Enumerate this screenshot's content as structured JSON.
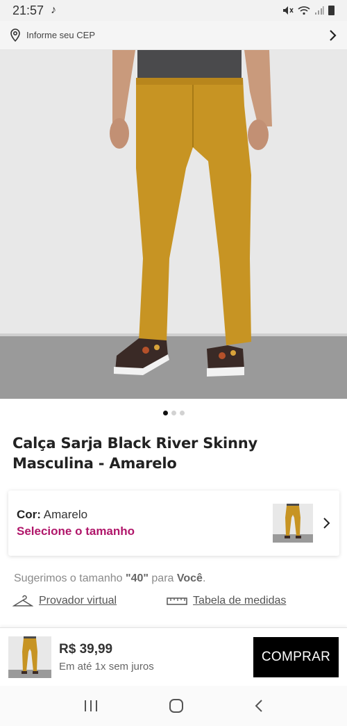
{
  "status_bar": {
    "time": "21:57",
    "icons": [
      "tiktok-icon",
      "mute-icon",
      "wifi-icon",
      "signal-icon",
      "battery-icon"
    ]
  },
  "cep_bar": {
    "label": "Informe seu CEP",
    "icon": "location-pin-icon"
  },
  "gallery": {
    "image_count": 3,
    "active_index": 0
  },
  "product": {
    "title": "Calça Sarja Black River Skinny Masculina - Amarelo"
  },
  "variant": {
    "cor_label": "Cor:",
    "cor_value": "Amarelo",
    "select_size": "Selecione o tamanho"
  },
  "size_suggestion": {
    "prefix": "Sugerimos o tamanho",
    "size": "\"40\"",
    "middle": "para",
    "target": "Você",
    "suffix": "."
  },
  "links": {
    "virtual_fitting": "Provador virtual",
    "size_chart": "Tabela de medidas"
  },
  "purchase": {
    "price": "R$ 39,99",
    "installment": "Em até 1x sem juros",
    "buy_label": "COMPRAR"
  },
  "colors": {
    "accent": "#b0166a",
    "pants": "#c79423",
    "buy_button": "#000000"
  }
}
